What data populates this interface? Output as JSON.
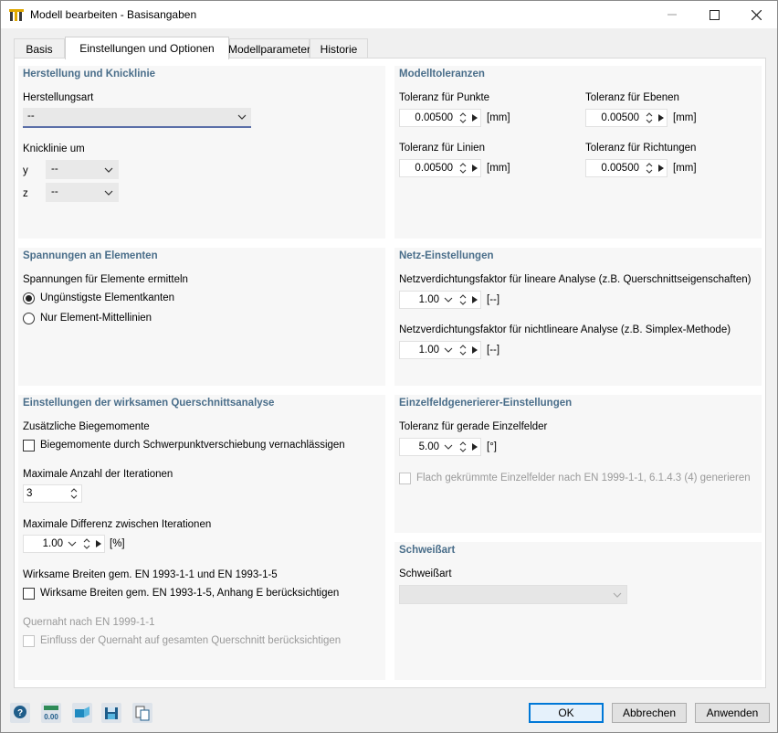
{
  "window": {
    "title": "Modell bearbeiten - Basisangaben"
  },
  "tabs": [
    "Basis",
    "Einstellungen und Optionen",
    "Modellparameter",
    "Historie"
  ],
  "herstellung": {
    "title": "Herstellung und Knicklinie",
    "herstellungsart_label": "Herstellungsart",
    "herstellungsart_value": "--",
    "knicklinie_label": "Knicklinie um",
    "y_label": "y",
    "y_value": "--",
    "z_label": "z",
    "z_value": "--"
  },
  "toleranzen": {
    "title": "Modelltoleranzen",
    "punkte_label": "Toleranz für Punkte",
    "punkte_value": "0.00500",
    "punkte_unit": "[mm]",
    "ebenen_label": "Toleranz für Ebenen",
    "ebenen_value": "0.00500",
    "ebenen_unit": "[mm]",
    "linien_label": "Toleranz für Linien",
    "linien_value": "0.00500",
    "linien_unit": "[mm]",
    "richtungen_label": "Toleranz für Richtungen",
    "richtungen_value": "0.00500",
    "richtungen_unit": "[mm]"
  },
  "spannungen": {
    "title": "Spannungen an Elementen",
    "label": "Spannungen für Elemente ermitteln",
    "option1": "Ungünstigste Elementkanten",
    "option2": "Nur Element-Mittellinien"
  },
  "netz": {
    "title": "Netz-Einstellungen",
    "linear_label": "Netzverdichtungsfaktor für lineare Analyse (z.B. Querschnittseigenschaften)",
    "linear_value": "1.00",
    "linear_unit": "[--]",
    "nonlinear_label": "Netzverdichtungsfaktor für nichtlineare Analyse (z.B. Simplex-Methode)",
    "nonlinear_value": "1.00",
    "nonlinear_unit": "[--]"
  },
  "querschnitt": {
    "title": "Einstellungen der wirksamen Querschnittsanalyse",
    "biegemomente_label": "Zusätzliche Biegemomente",
    "biegemomente_check": "Biegemomente durch Schwerpunktverschiebung vernachlässigen",
    "iterationen_label": "Maximale Anzahl der Iterationen",
    "iterationen_value": "3",
    "differenz_label": "Maximale Differenz zwischen Iterationen",
    "differenz_value": "1.00",
    "differenz_unit": "[%]",
    "breiten_label": "Wirksame Breiten gem. EN 1993-1-1 und EN 1993-1-5",
    "breiten_check": "Wirksame Breiten gem. EN 1993-1-5, Anhang E berücksichtigen",
    "quernaht_label": "Quernaht nach EN 1999-1-1",
    "quernaht_check": "Einfluss der Quernaht auf gesamten Querschnitt berücksichtigen"
  },
  "einzelfeld": {
    "title": "Einzelfeldgenerierer-Einstellungen",
    "toleranz_label": "Toleranz für gerade Einzelfelder",
    "toleranz_value": "5.00",
    "toleranz_unit": "[°]",
    "flach_check": "Flach gekrümmte Einzelfelder nach EN 1999-1-1, 6.1.4.3 (4) generieren"
  },
  "schweiss": {
    "title": "Schweißart",
    "label": "Schweißart",
    "value": ""
  },
  "buttons": {
    "ok": "OK",
    "cancel": "Abbrechen",
    "apply": "Anwenden"
  },
  "toolbar_icons": [
    "help-icon",
    "units-icon",
    "view-icon",
    "save-icon",
    "copy-icon"
  ],
  "colors": {
    "section_title": "#4a6e8a",
    "accent": "#0078d7"
  }
}
